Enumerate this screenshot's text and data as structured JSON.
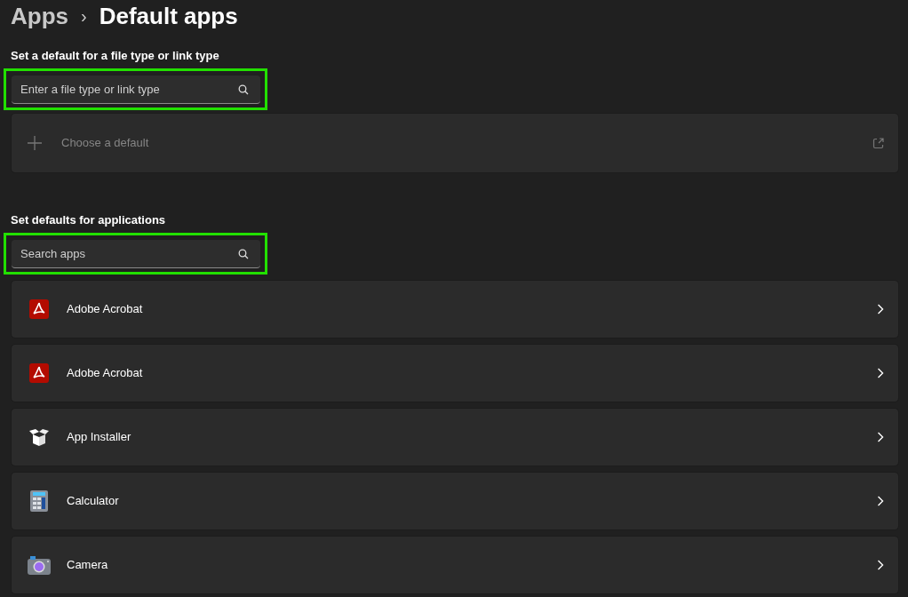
{
  "breadcrumb": {
    "parent": "Apps",
    "separator": "›",
    "current": "Default apps"
  },
  "file_type_section": {
    "heading": "Set a default for a file type or link type",
    "search": {
      "placeholder": "Enter a file type or link type",
      "highlighted": true
    },
    "choose_default": {
      "label": "Choose a default",
      "disabled": true
    }
  },
  "apps_section": {
    "heading": "Set defaults for applications",
    "search": {
      "placeholder": "Search apps",
      "highlighted": true
    },
    "apps": [
      {
        "name": "Adobe Acrobat",
        "kind": "pdf"
      },
      {
        "name": "Adobe Acrobat",
        "kind": "pdf"
      },
      {
        "name": "App Installer",
        "kind": "box"
      },
      {
        "name": "Calculator",
        "kind": "calculator"
      },
      {
        "name": "Camera",
        "kind": "camera"
      }
    ]
  }
}
